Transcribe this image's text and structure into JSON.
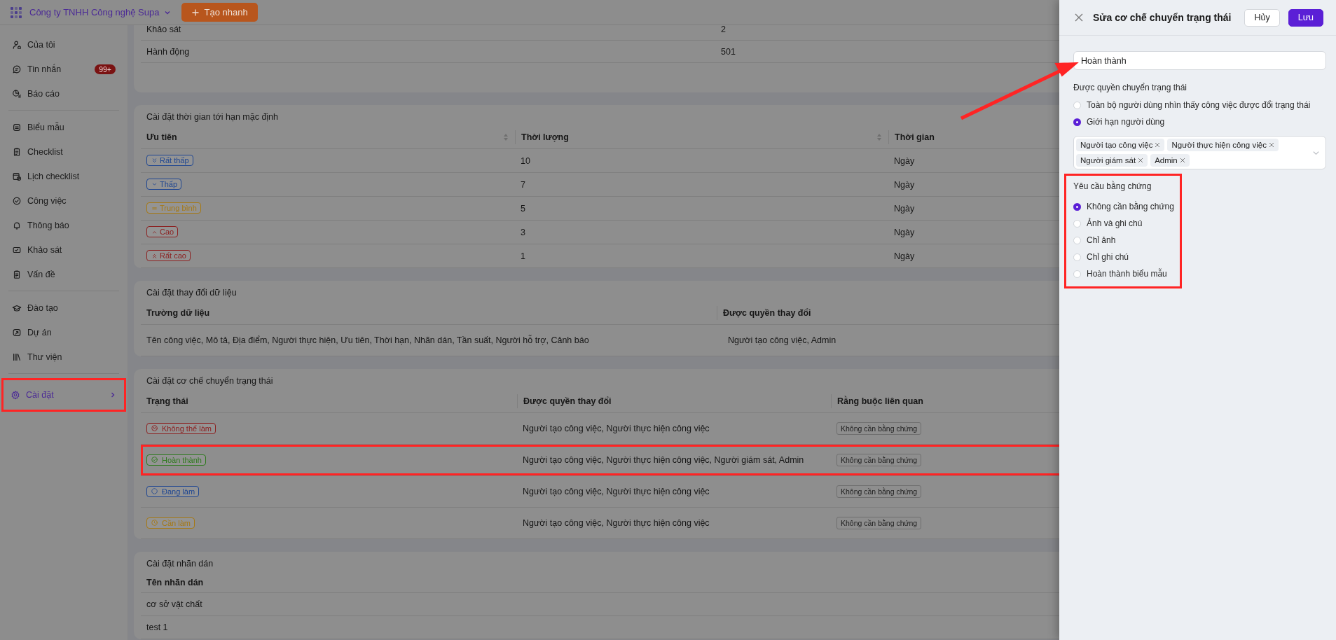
{
  "topbar": {
    "company": "Công ty TNHH Công nghệ Supa",
    "quick_create": "Tạo nhanh"
  },
  "sidebar": {
    "groups": [
      [
        {
          "label": "Của tôi",
          "selected": false,
          "highlighted": false,
          "submenu": false
        },
        {
          "label": "Tin nhắn",
          "badge": "99+",
          "selected": false,
          "highlighted": false,
          "submenu": false
        },
        {
          "label": "Báo cáo",
          "selected": false,
          "highlighted": false,
          "submenu": false
        }
      ],
      [
        {
          "label": "Biểu mẫu",
          "selected": false,
          "highlighted": false,
          "submenu": false
        },
        {
          "label": "Checklist",
          "selected": false,
          "highlighted": false,
          "submenu": false
        },
        {
          "label": "Lịch checklist",
          "selected": false,
          "highlighted": false,
          "submenu": false
        },
        {
          "label": "Công việc",
          "selected": false,
          "highlighted": false,
          "submenu": false
        },
        {
          "label": "Thông báo",
          "selected": false,
          "highlighted": false,
          "submenu": false
        },
        {
          "label": "Khảo sát",
          "selected": false,
          "highlighted": false,
          "submenu": false
        },
        {
          "label": "Vấn đề",
          "selected": false,
          "highlighted": false,
          "submenu": false
        }
      ],
      [
        {
          "label": "Đào tạo",
          "selected": false,
          "highlighted": false,
          "submenu": false
        },
        {
          "label": "Dự án",
          "selected": false,
          "highlighted": false,
          "submenu": false
        },
        {
          "label": "Thư viện",
          "selected": false,
          "highlighted": false,
          "submenu": false
        }
      ],
      [
        {
          "label": "Cài đặt",
          "selected": true,
          "highlighted": true,
          "submenu": true
        }
      ]
    ]
  },
  "summary_card": {
    "rows": [
      {
        "label": "Khảo sát",
        "value": "2"
      },
      {
        "label": "Hành động",
        "value": "501"
      }
    ]
  },
  "deadline_settings": {
    "title": "Cài đặt thời gian tới hạn mặc định",
    "columns": [
      "Ưu tiên",
      "Thời lượng",
      "Thời gian"
    ],
    "rows": [
      {
        "priority": "Rất thấp",
        "color": "#1d4591",
        "duration": "10",
        "unit": "Ngày"
      },
      {
        "priority": "Thấp",
        "color": "#1d4591",
        "duration": "7",
        "unit": "Ngày"
      },
      {
        "priority": "Trung bình",
        "color": "#a67812",
        "duration": "5",
        "unit": "Ngày"
      },
      {
        "priority": "Cao",
        "color": "#8c2020",
        "duration": "3",
        "unit": "Ngày"
      },
      {
        "priority": "Rất cao",
        "color": "#8c2020",
        "duration": "1",
        "unit": "Ngày"
      }
    ]
  },
  "data_change_settings": {
    "title": "Cài đặt thay đổi dữ liệu",
    "columns": [
      "Trường dữ liệu",
      "Được quyền thay đổi"
    ],
    "rows": [
      {
        "fields": "Tên công việc, Mô tả, Địa điểm, Người thực hiện, Ưu tiên, Thời hạn, Nhãn dán, Tần suất, Người hỗ trợ, Cảnh báo",
        "editors": "Người tạo công việc, Admin"
      }
    ]
  },
  "status_transition_settings": {
    "title": "Cài đặt cơ chế chuyển trạng thái",
    "columns": [
      "Trạng thái",
      "Được quyền thay đổi",
      "Rằng buộc liên quan"
    ],
    "rows": [
      {
        "status": "Không thể làm",
        "color": "#8c2020",
        "editors": "Người tạo công việc, Người thực hiện công việc",
        "constraint": "Không cần bằng chứng",
        "highlighted": false
      },
      {
        "status": "Hoàn thành",
        "color": "#2d7a1c",
        "editors": "Người tạo công việc, Người thực hiện công việc, Người giám sát, Admin",
        "constraint": "Không cần bằng chứng",
        "highlighted": true
      },
      {
        "status": "Đang làm",
        "color": "#1d4591",
        "editors": "Người tạo công việc, Người thực hiện công việc",
        "constraint": "Không cần bằng chứng",
        "highlighted": false
      },
      {
        "status": "Cần làm",
        "color": "#a67812",
        "editors": "Người tạo công việc, Người thực hiện công việc",
        "constraint": "Không cần bằng chứng",
        "highlighted": false
      }
    ]
  },
  "label_settings": {
    "title": "Cài đặt nhãn dán",
    "columns": [
      "Tên nhãn dán"
    ],
    "rows": [
      "cơ sở vật chất",
      "test 1"
    ]
  },
  "drawer": {
    "title": "Sửa cơ chế chuyển trạng thái",
    "cancel": "Hủy",
    "save": "Lưu",
    "name_value": "Hoàn thành",
    "permission_label": "Được quyền chuyển trạng thái",
    "permission_options": [
      {
        "label": "Toàn bộ người dùng nhìn thấy công việc được đổi trạng thái",
        "selected": false
      },
      {
        "label": "Giới hạn người dùng",
        "selected": true
      }
    ],
    "users": [
      "Người tạo công việc",
      "Người thực hiện công việc",
      "Người giám sát",
      "Admin"
    ],
    "evidence_label": "Yêu cầu bằng chứng",
    "evidence_highlighted": true,
    "evidence_options": [
      {
        "label": "Không cần bằng chứng",
        "selected": true
      },
      {
        "label": "Ảnh và ghi chú",
        "selected": false
      },
      {
        "label": "Chỉ ảnh",
        "selected": false
      },
      {
        "label": "Chỉ ghi chú",
        "selected": false
      },
      {
        "label": "Hoàn thành biểu mẫu",
        "selected": false
      }
    ]
  }
}
